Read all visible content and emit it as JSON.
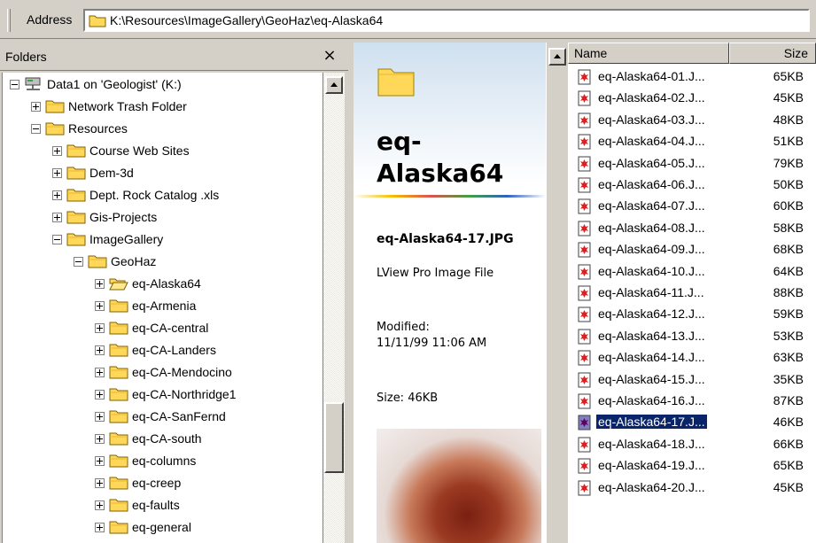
{
  "address_bar": {
    "label": "Address",
    "path": "K:\\Resources\\ImageGallery\\GeoHaz\\eq-Alaska64"
  },
  "folders_pane": {
    "title": "Folders",
    "close_glyph": "×",
    "tree": [
      {
        "label": "Data1 on 'Geologist' (K:)",
        "level": 0,
        "toggle": "minus",
        "icon": "network-drive-icon"
      },
      {
        "label": "Network Trash Folder",
        "level": 1,
        "toggle": "plus",
        "icon": "folder-icon"
      },
      {
        "label": "Resources",
        "level": 1,
        "toggle": "minus",
        "icon": "folder-icon"
      },
      {
        "label": "Course Web Sites",
        "level": 2,
        "toggle": "plus",
        "icon": "folder-icon"
      },
      {
        "label": "Dem-3d",
        "level": 2,
        "toggle": "plus",
        "icon": "folder-icon"
      },
      {
        "label": "Dept. Rock Catalog .xls",
        "level": 2,
        "toggle": "plus",
        "icon": "folder-icon"
      },
      {
        "label": "Gis-Projects",
        "level": 2,
        "toggle": "plus",
        "icon": "folder-icon"
      },
      {
        "label": "ImageGallery",
        "level": 2,
        "toggle": "minus",
        "icon": "folder-icon"
      },
      {
        "label": "GeoHaz",
        "level": 3,
        "toggle": "minus",
        "icon": "folder-icon"
      },
      {
        "label": "eq-Alaska64",
        "level": 4,
        "toggle": "plus",
        "icon": "open-folder-icon"
      },
      {
        "label": "eq-Armenia",
        "level": 4,
        "toggle": "plus",
        "icon": "folder-icon"
      },
      {
        "label": "eq-CA-central",
        "level": 4,
        "toggle": "plus",
        "icon": "folder-icon"
      },
      {
        "label": "eq-CA-Landers",
        "level": 4,
        "toggle": "plus",
        "icon": "folder-icon"
      },
      {
        "label": "eq-CA-Mendocino",
        "level": 4,
        "toggle": "plus",
        "icon": "folder-icon"
      },
      {
        "label": "eq-CA-Northridge1",
        "level": 4,
        "toggle": "plus",
        "icon": "folder-icon"
      },
      {
        "label": "eq-CA-SanFernd",
        "level": 4,
        "toggle": "plus",
        "icon": "folder-icon"
      },
      {
        "label": "eq-CA-south",
        "level": 4,
        "toggle": "plus",
        "icon": "folder-icon"
      },
      {
        "label": "eq-columns",
        "level": 4,
        "toggle": "plus",
        "icon": "folder-icon"
      },
      {
        "label": "eq-creep",
        "level": 4,
        "toggle": "plus",
        "icon": "folder-icon"
      },
      {
        "label": "eq-faults",
        "level": 4,
        "toggle": "plus",
        "icon": "folder-icon"
      },
      {
        "label": "eq-general",
        "level": 4,
        "toggle": "plus",
        "icon": "folder-icon"
      }
    ]
  },
  "webview": {
    "folder_title": "eq-Alaska64",
    "file_name": "eq-Alaska64-17.JPG",
    "file_type": "LView Pro Image File",
    "modified_label": "Modified:",
    "modified_value": "11/11/99 11:06 AM",
    "size_text": "Size: 46KB"
  },
  "file_list": {
    "columns": {
      "name": "Name",
      "size": "Size"
    },
    "selected_index": 16,
    "files": [
      {
        "name": "eq-Alaska64-01.J...",
        "size": "65KB"
      },
      {
        "name": "eq-Alaska64-02.J...",
        "size": "45KB"
      },
      {
        "name": "eq-Alaska64-03.J...",
        "size": "48KB"
      },
      {
        "name": "eq-Alaska64-04.J...",
        "size": "51KB"
      },
      {
        "name": "eq-Alaska64-05.J...",
        "size": "79KB"
      },
      {
        "name": "eq-Alaska64-06.J...",
        "size": "50KB"
      },
      {
        "name": "eq-Alaska64-07.J...",
        "size": "60KB"
      },
      {
        "name": "eq-Alaska64-08.J...",
        "size": "58KB"
      },
      {
        "name": "eq-Alaska64-09.J...",
        "size": "68KB"
      },
      {
        "name": "eq-Alaska64-10.J...",
        "size": "64KB"
      },
      {
        "name": "eq-Alaska64-11.J...",
        "size": "88KB"
      },
      {
        "name": "eq-Alaska64-12.J...",
        "size": "59KB"
      },
      {
        "name": "eq-Alaska64-13.J...",
        "size": "53KB"
      },
      {
        "name": "eq-Alaska64-14.J...",
        "size": "63KB"
      },
      {
        "name": "eq-Alaska64-15.J...",
        "size": "35KB"
      },
      {
        "name": "eq-Alaska64-16.J...",
        "size": "87KB"
      },
      {
        "name": "eq-Alaska64-17.J...",
        "size": "46KB"
      },
      {
        "name": "eq-Alaska64-18.J...",
        "size": "66KB"
      },
      {
        "name": "eq-Alaska64-19.J...",
        "size": "65KB"
      },
      {
        "name": "eq-Alaska64-20.J...",
        "size": "45KB"
      }
    ]
  },
  "colors": {
    "chrome": "#d4d0c8",
    "selection": "#0a246a",
    "folder_yellow": "#ffd85a"
  }
}
